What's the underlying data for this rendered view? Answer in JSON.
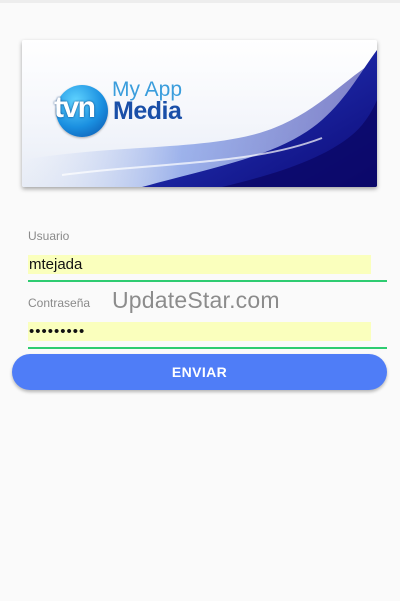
{
  "banner": {
    "logo_mark": "tvn",
    "logo_line1": "My App",
    "logo_line2": "Media"
  },
  "form": {
    "username_label": "Usuario",
    "username_value": "mtejada",
    "password_label": "Contraseña",
    "password_value": "•••••••••",
    "submit_label": "ENVIAR"
  },
  "watermark": "UpdateStar.com",
  "colors": {
    "accent_button": "#4f7df7",
    "field_underline": "#2ecc71",
    "autofill_background": "#faffbd",
    "logo_blue": "#1a4fa8",
    "logo_light_blue": "#3a9ddc"
  }
}
